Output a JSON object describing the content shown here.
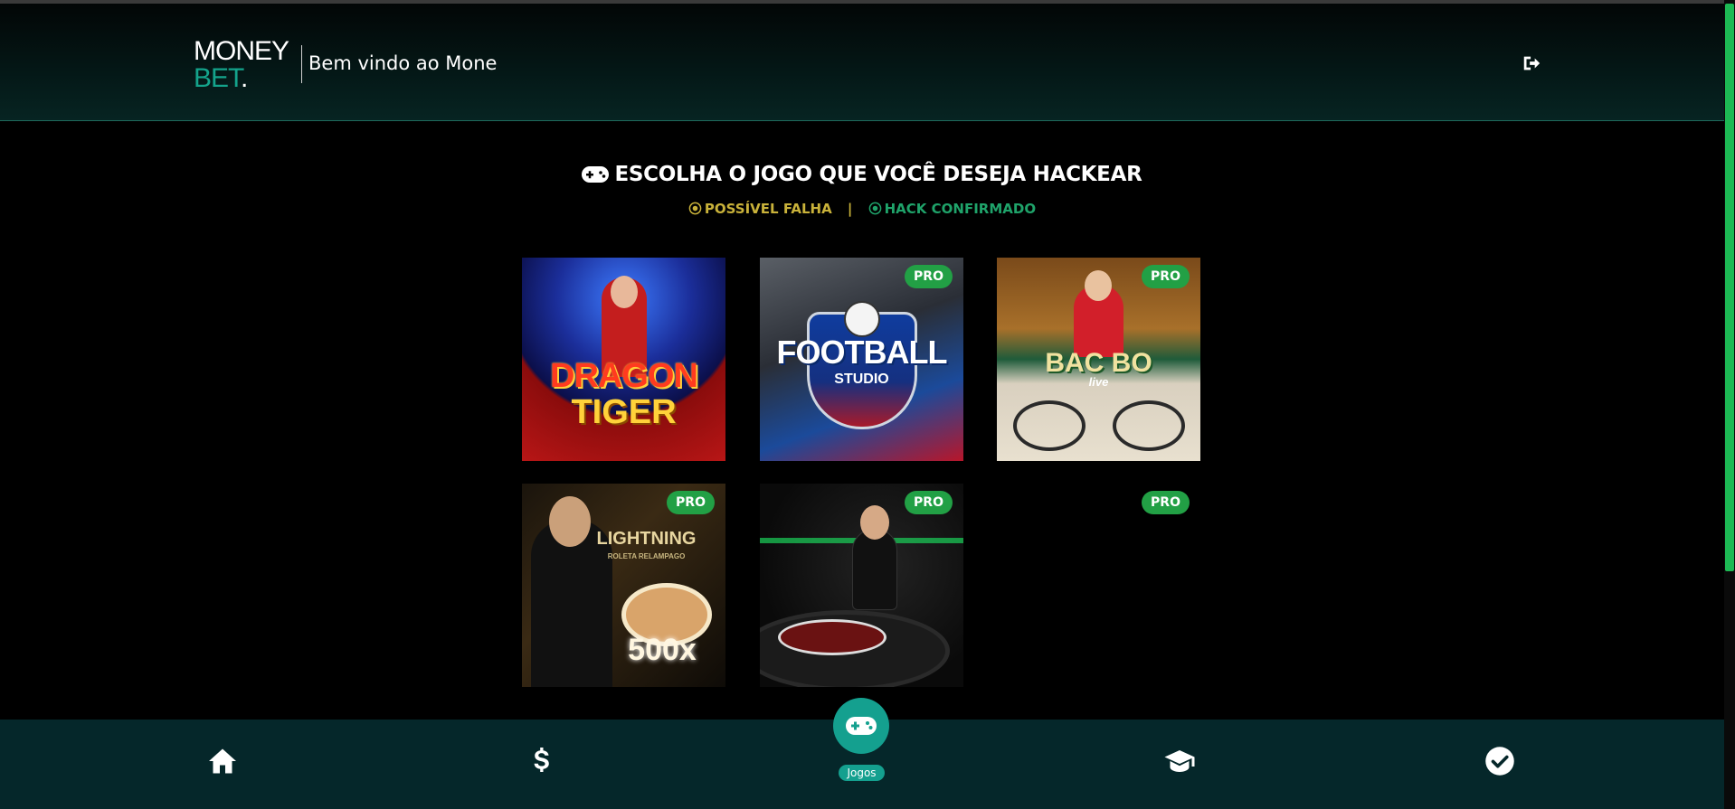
{
  "header": {
    "logo_line1": "MONEY",
    "logo_line2": "BET",
    "logo_dot": ".",
    "welcome": "Bem vindo ao Mone",
    "logout_icon": "sign-out-icon"
  },
  "main": {
    "title": "ESCOLHA O JOGO QUE VOCÊ DESEJA HACKEAR",
    "title_icon": "gamepad-icon",
    "legend": {
      "possible_fail": "POSSÍVEL FALHA",
      "separator": "|",
      "confirmed": "HACK CONFIRMADO",
      "possible_fail_color": "#c9b23a",
      "confirmed_color": "#1fa36a"
    }
  },
  "games": [
    {
      "title_line1": "DRAGON",
      "title_line2": "TIGER",
      "badge": ""
    },
    {
      "title_line1": "FOOTBALL",
      "title_line2": "STUDIO",
      "badge": "PRO"
    },
    {
      "title_line1": "BAC BO",
      "title_line2": "live",
      "badge": "PRO"
    },
    {
      "title_line1": "LIGHTNING",
      "title_line2": "ROLETA RELAMPAGO",
      "extra": "500x",
      "badge": "PRO"
    },
    {
      "title_line1": "",
      "title_line2": "",
      "badge": "PRO"
    },
    {
      "title_line1": "",
      "title_line2": "",
      "badge": "PRO"
    }
  ],
  "nav": {
    "items": [
      "home-icon",
      "dollar-icon",
      "gamepad-icon",
      "graduation-cap-icon",
      "check-circle-icon"
    ],
    "active_label": "Jogos",
    "accent": "#14a08f"
  }
}
